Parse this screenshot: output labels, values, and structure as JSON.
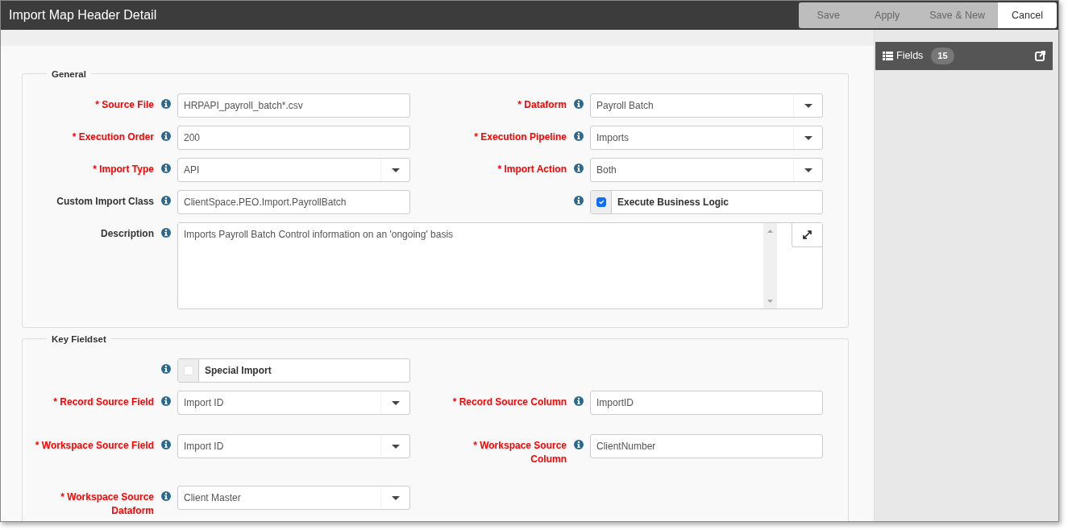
{
  "window": {
    "title": "Import Map Header Detail"
  },
  "buttons": [
    {
      "label": "Save",
      "disabled": true
    },
    {
      "label": "Apply",
      "disabled": true
    },
    {
      "label": "Save & New",
      "disabled": true
    },
    {
      "label": "Cancel",
      "disabled": false
    }
  ],
  "sections": [
    {
      "legend": "General",
      "rows": [
        [
          {
            "kind": "text",
            "label": "* Source File",
            "required": true,
            "value": "HRPAPI_payroll_batch*.csv"
          },
          {
            "kind": "select",
            "label": "* Dataform",
            "required": true,
            "value": "Payroll Batch"
          }
        ],
        [
          {
            "kind": "text",
            "label": "* Execution Order",
            "required": true,
            "value": "200"
          },
          {
            "kind": "select",
            "label": "* Execution Pipeline",
            "required": true,
            "value": "Imports"
          }
        ],
        [
          {
            "kind": "select",
            "label": "* Import Type",
            "required": true,
            "value": "API"
          },
          {
            "kind": "select",
            "label": "* Import Action",
            "required": true,
            "value": "Both"
          }
        ],
        [
          {
            "kind": "text",
            "label": "Custom Import Class",
            "required": false,
            "value": "ClientSpace.PEO.Import.PayrollBatch"
          },
          {
            "kind": "checkbox",
            "value": "Execute Business Logic",
            "checked": true
          }
        ],
        [
          {
            "kind": "textarea",
            "label": "Description",
            "required": false,
            "value": "Imports Payroll Batch Control information on an 'ongoing' basis"
          }
        ]
      ]
    },
    {
      "legend": "Key Fieldset",
      "rows": [
        [
          {
            "kind": "checkbox",
            "value": "Special Import",
            "checked": false
          }
        ],
        [
          {
            "kind": "select",
            "label": "* Record Source Field",
            "required": true,
            "value": "Import ID"
          },
          {
            "kind": "text",
            "label": "* Record Source Column",
            "required": true,
            "value": "ImportID"
          }
        ],
        [
          {
            "kind": "select",
            "label": "* Workspace Source Field",
            "required": true,
            "value": "Import ID"
          },
          {
            "kind": "text",
            "label": "* Workspace Source Column",
            "required": true,
            "value": "ClientNumber"
          }
        ],
        [
          {
            "kind": "select",
            "label": "* Workspace Source Dataform",
            "required": true,
            "value": "Client Master"
          }
        ]
      ]
    }
  ],
  "sidebar": {
    "title": "Fields",
    "count": "15"
  }
}
